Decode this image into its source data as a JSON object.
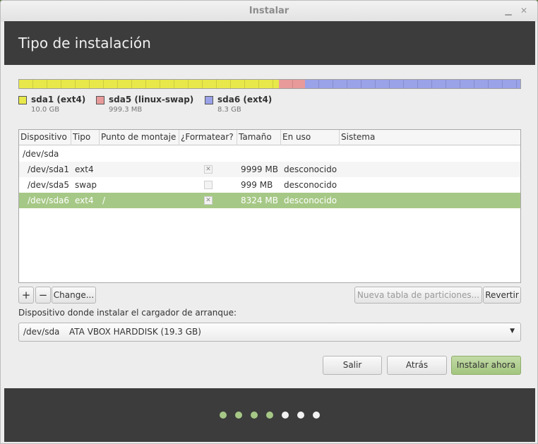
{
  "window": {
    "title": "Instalar",
    "min_icon": "minimize-icon",
    "close_icon": "close-icon"
  },
  "header": {
    "title": "Tipo de instalación"
  },
  "partition_bar": [
    {
      "name": "sda1",
      "color": "#e8e84a",
      "fraction": 0.518
    },
    {
      "name": "sda5",
      "color": "#e89a9a",
      "fraction": 0.052
    },
    {
      "name": "sda6",
      "color": "#9aa2e8",
      "fraction": 0.43
    }
  ],
  "legend": [
    {
      "label": "sda1 (ext4)",
      "size": "10.0 GB",
      "color": "#e8e84a"
    },
    {
      "label": "sda5 (linux-swap)",
      "size": "999.3 MB",
      "color": "#e89a9a"
    },
    {
      "label": "sda6 (ext4)",
      "size": "8.3 GB",
      "color": "#9aa2e8"
    }
  ],
  "table": {
    "columns": [
      "Dispositivo",
      "Tipo",
      "Punto de montaje",
      "¿Formatear?",
      "Tamaño",
      "En uso",
      "Sistema"
    ],
    "group": "/dev/sda",
    "rows": [
      {
        "device": "/dev/sda1",
        "type": "ext4",
        "mount": "",
        "format": "checked",
        "size": "9999 MB",
        "used": "desconocido",
        "system": ""
      },
      {
        "device": "/dev/sda5",
        "type": "swap",
        "mount": "",
        "format": "unchecked",
        "size": "999 MB",
        "used": "desconocido",
        "system": ""
      },
      {
        "device": "/dev/sda6",
        "type": "ext4",
        "mount": "/",
        "format": "checked",
        "size": "8324 MB",
        "used": "desconocido",
        "system": ""
      }
    ]
  },
  "toolbar": {
    "add_label": "+",
    "remove_label": "−",
    "change_label": "Change...",
    "new_table_label": "Nueva tabla de particiones...",
    "revert_label": "Revertir"
  },
  "bootloader": {
    "label": "Dispositivo donde instalar el cargador de arranque:",
    "device": "/dev/sda",
    "description": "ATA VBOX HARDDISK (19.3 GB)"
  },
  "actions": {
    "quit_label": "Salir",
    "back_label": "Atrás",
    "install_label": "Instalar ahora"
  },
  "progress": {
    "total_steps": 7,
    "completed_steps": 4,
    "active_color": "#a6c886",
    "inactive_color": "#f2f2f2"
  }
}
